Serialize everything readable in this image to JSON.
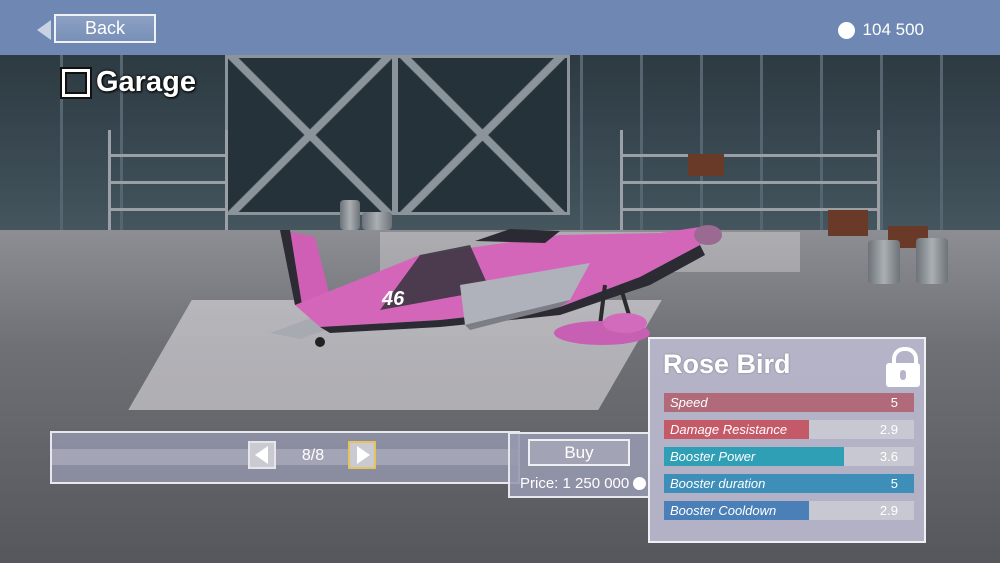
{
  "header": {
    "back_label": "Back",
    "coins": "104 500"
  },
  "garage_title": "Garage",
  "nav": {
    "counter": "8/8"
  },
  "plane": {
    "number": "46",
    "body_color": "#d266b8"
  },
  "buy": {
    "label": "Buy",
    "price": "Price: 1 250 000"
  },
  "stats": {
    "name": "Rose Bird",
    "locked": true,
    "items": [
      {
        "label": "Speed",
        "value": "5",
        "fraction": 1.0,
        "color": "#b06a7a"
      },
      {
        "label": "Damage Resistance",
        "value": "2.9",
        "fraction": 0.58,
        "color": "#c45a68"
      },
      {
        "label": "Booster Power",
        "value": "3.6",
        "fraction": 0.72,
        "color": "#2f9fb6"
      },
      {
        "label": "Booster duration",
        "value": "5",
        "fraction": 1.0,
        "color": "#3d8eb8"
      },
      {
        "label": "Booster Cooldown",
        "value": "2.9",
        "fraction": 0.58,
        "color": "#4a7fb8"
      }
    ]
  },
  "colors": {
    "topbar": "#6e87b3",
    "panel": "#b9b7cf"
  }
}
